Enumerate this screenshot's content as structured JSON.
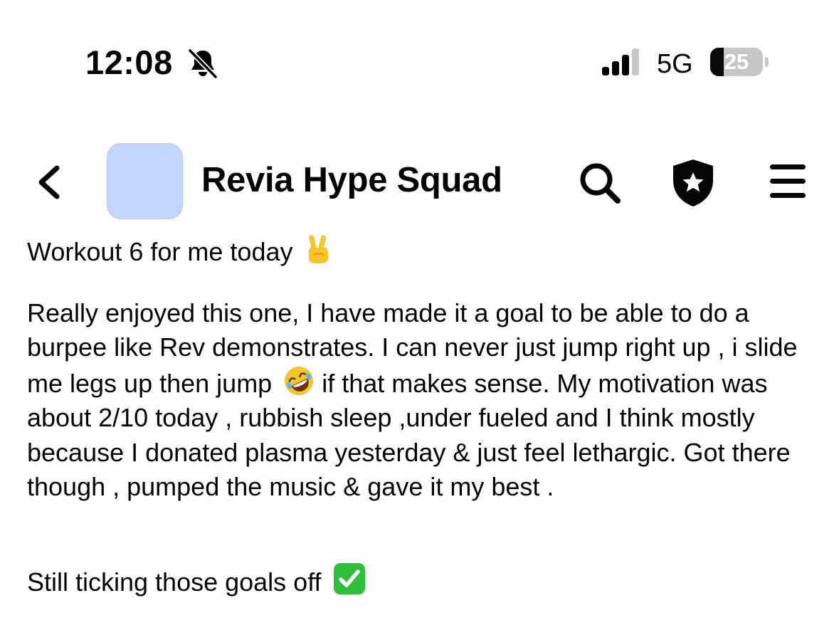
{
  "status_bar": {
    "time": "12:08",
    "network": "5G",
    "battery_percent": "25",
    "battery_level": 0.25,
    "icons": [
      "bell-muted-icon",
      "cellular-signal-icon",
      "battery-icon"
    ]
  },
  "header": {
    "back_icon": "chevron-left-icon",
    "group_name": "Revia Hype Squad",
    "avatar_color": "#c3d4fd",
    "action_icons": [
      "search-icon",
      "admin-shield-star-icon",
      "menu-icon"
    ]
  },
  "post": {
    "heading": "Workout 6 for me today",
    "heading_emoji": "victory-hand-emoji",
    "body_part1": "Really enjoyed this one, I have made it a goal to be able to do a burpee like Rev demonstrates. I can never just jump right up , i slide me legs up then jump",
    "body_emoji": "rolling-on-floor-laughing-emoji",
    "body_part2": "if that makes sense. My motivation was about 2/10 today , rubbish sleep ,under fueled and I think mostly because I donated plasma yesterday & just feel lethargic. Got there though , pumped the music & gave it my best .",
    "footer": "Still ticking those goals off",
    "footer_emoji": "check-mark-button-emoji"
  },
  "colors": {
    "text": "#050505",
    "background": "#ffffff",
    "check_green": "#2fbf3a",
    "emoji_yellow": "#f6c42b"
  }
}
